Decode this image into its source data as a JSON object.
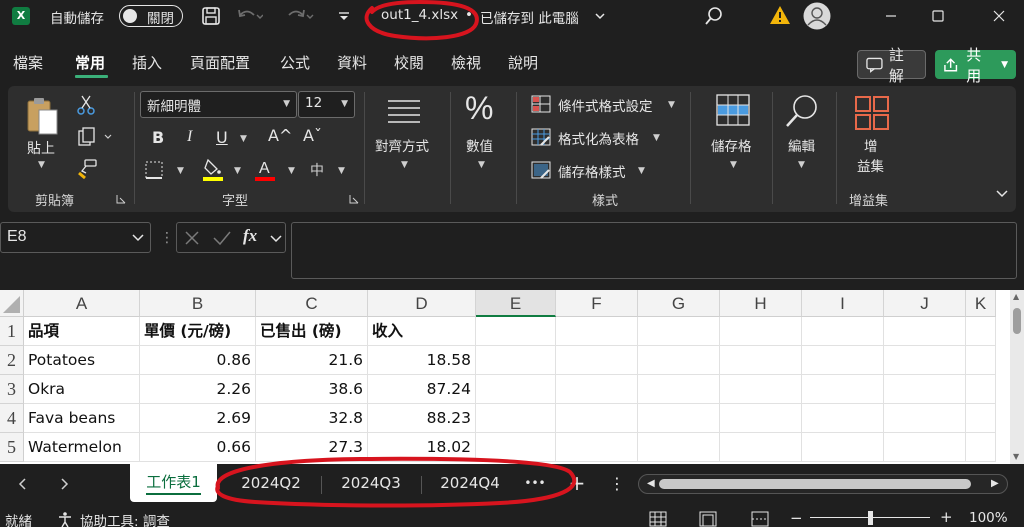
{
  "titlebar": {
    "app_logo": "X",
    "autosave_label": "自動儲存",
    "toggle_label": "關閉",
    "filename": "out1_4.xlsx",
    "dot": "•",
    "save_status": "已儲存到 此電腦",
    "icons": [
      "save-icon",
      "undo-icon",
      "redo-icon",
      "customize-icon",
      "search-icon",
      "warning-icon",
      "avatar-icon",
      "minimize-icon",
      "maximize-icon",
      "close-icon"
    ]
  },
  "menu": {
    "tabs": [
      "檔案",
      "常用",
      "插入",
      "頁面配置",
      "公式",
      "資料",
      "校閱",
      "檢視",
      "說明"
    ],
    "active": "常用",
    "comment_label": "註解",
    "share_label": "共用"
  },
  "ribbon": {
    "clipboard": {
      "paste_label": "貼上",
      "group_label": "剪貼簿"
    },
    "font": {
      "font_name": "新細明體",
      "font_size": "12",
      "bold": "B",
      "italic": "I",
      "underline": "U",
      "grow": "A^",
      "shrink": "Aˇ",
      "phonetic": "中",
      "group_label": "字型"
    },
    "alignment": {
      "label": "對齊方式"
    },
    "number": {
      "label": "數值"
    },
    "styles": {
      "conditional": "條件式格式設定",
      "as_table": "格式化為表格",
      "cell_styles": "儲存格樣式",
      "group_label": "樣式"
    },
    "cells": {
      "label": "儲存格"
    },
    "editing": {
      "label": "編輯"
    },
    "addins": {
      "label_line1": "增",
      "label_line2": "益集",
      "group_label": "增益集"
    },
    "colors": {
      "highlight": "#ffff00",
      "font_color": "#ff0000"
    }
  },
  "formula_bar": {
    "name_box": "E8",
    "fx": "fx",
    "value": ""
  },
  "grid": {
    "columns": [
      "A",
      "B",
      "C",
      "D",
      "E",
      "F",
      "G",
      "H",
      "I",
      "J",
      "K"
    ],
    "rows": [
      "1",
      "2",
      "3",
      "4",
      "5"
    ],
    "data": [
      [
        "品項",
        "單價 (元/磅)",
        "已售出 (磅)",
        "收入"
      ],
      [
        "Potatoes",
        "0.86",
        "21.6",
        "18.58"
      ],
      [
        "Okra",
        "2.26",
        "38.6",
        "87.24"
      ],
      [
        "Fava beans",
        "2.69",
        "32.8",
        "88.23"
      ],
      [
        "Watermelon",
        "0.66",
        "27.3",
        "18.02"
      ]
    ]
  },
  "sheets": {
    "tabs": [
      "工作表1",
      "2024Q2",
      "2024Q3",
      "2024Q4"
    ],
    "active": "工作表1",
    "more": "•••",
    "add": "+",
    "options": "⋮"
  },
  "status": {
    "ready": "就緒",
    "accessibility": "協助工具: 調查",
    "zoom": "100%"
  }
}
